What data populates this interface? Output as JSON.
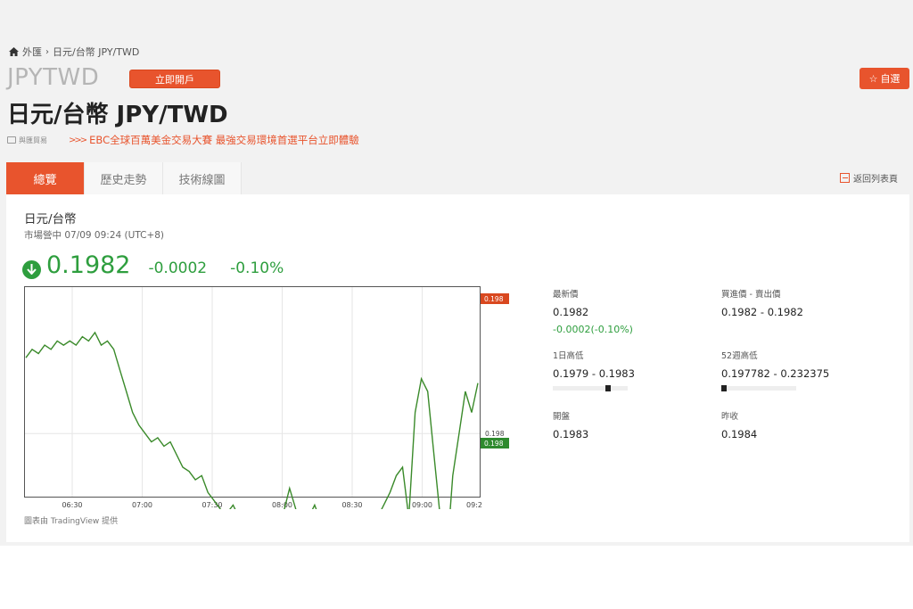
{
  "breadcrumb": {
    "home": "外匯",
    "current": "日元/台幣 JPY/TWD"
  },
  "symbol": "JPYTWD",
  "open_account_label": "立即開戶",
  "watchlist_label": "自選",
  "title": "日元/台幣 JPY/TWD",
  "promo": {
    "tag": "與匯貿易",
    "arrows": ">>>",
    "text": "EBC全球百萬美金交易大賽 最強交易環境首選平台立即體驗"
  },
  "tabs": [
    "總覽",
    "歷史走勢",
    "技術線圖"
  ],
  "back_link": "返回列表頁",
  "quote": {
    "pair": "日元/台幣",
    "status": "市場營中 07/09 09:24 (UTC+8)",
    "price": "0.1982",
    "change": "-0.0002",
    "change_pct": "-0.10%"
  },
  "stats": {
    "last": {
      "label": "最新價",
      "value": "0.1982",
      "sub": "-0.0002(-0.10%)"
    },
    "bid_ask": {
      "label": "買進價 - 賣出價",
      "value": "0.1982 - 0.1982"
    },
    "day_range": {
      "label": "1日高低",
      "value": "0.1979 - 0.1983",
      "position": 0.75
    },
    "week52_range": {
      "label": "52週高低",
      "value": "0.197782 - 0.232375",
      "position": 0.0
    },
    "open": {
      "label": "開盤",
      "value": "0.1983"
    },
    "prev_close": {
      "label": "昨收",
      "value": "0.1984"
    }
  },
  "chart_credit": "圖表由 TradingView 提供",
  "colors": {
    "accent": "#e8542d",
    "up_down_green": "#2e9e3e",
    "price_tag_red": "#d9481f"
  },
  "chart_data": {
    "type": "line",
    "x_ticks": [
      "06:30",
      "07:00",
      "07:30",
      "08:00",
      "08:30",
      "09:00",
      "09:2"
    ],
    "y_tick_labels": [
      "0.198"
    ],
    "price_tags": {
      "upper": "0.198",
      "lower": "0.198"
    },
    "ylim": [
      0.19785,
      0.19835
    ],
    "x_range": [
      "06:20",
      "09:25"
    ],
    "series": [
      {
        "values": [
          0.19818,
          0.1982,
          0.19819,
          0.19821,
          0.1982,
          0.19822,
          0.19821,
          0.19822,
          0.19821,
          0.19823,
          0.19822,
          0.19824,
          0.19821,
          0.19822,
          0.1982,
          0.19815,
          0.1981,
          0.19805,
          0.19802,
          0.198,
          0.19798,
          0.19799,
          0.19797,
          0.19798,
          0.19795,
          0.19792,
          0.19791,
          0.19789,
          0.1979,
          0.19786,
          0.19784,
          0.19782,
          0.19781,
          0.19783,
          0.1978,
          0.19779,
          0.19777,
          0.19778,
          0.19776,
          0.19777,
          0.19776,
          0.19781,
          0.19787,
          0.19782,
          0.19777,
          0.1978,
          0.19783,
          0.19779,
          0.19778,
          0.1978,
          0.19776,
          0.19777,
          0.19775,
          0.19772,
          0.19775,
          0.19778,
          0.1978,
          0.19783,
          0.19786,
          0.1979,
          0.19792,
          0.1978,
          0.19805,
          0.19813,
          0.1981,
          0.19795,
          0.1978,
          0.1977,
          0.1979,
          0.198,
          0.1981,
          0.19805,
          0.19812
        ]
      }
    ]
  }
}
